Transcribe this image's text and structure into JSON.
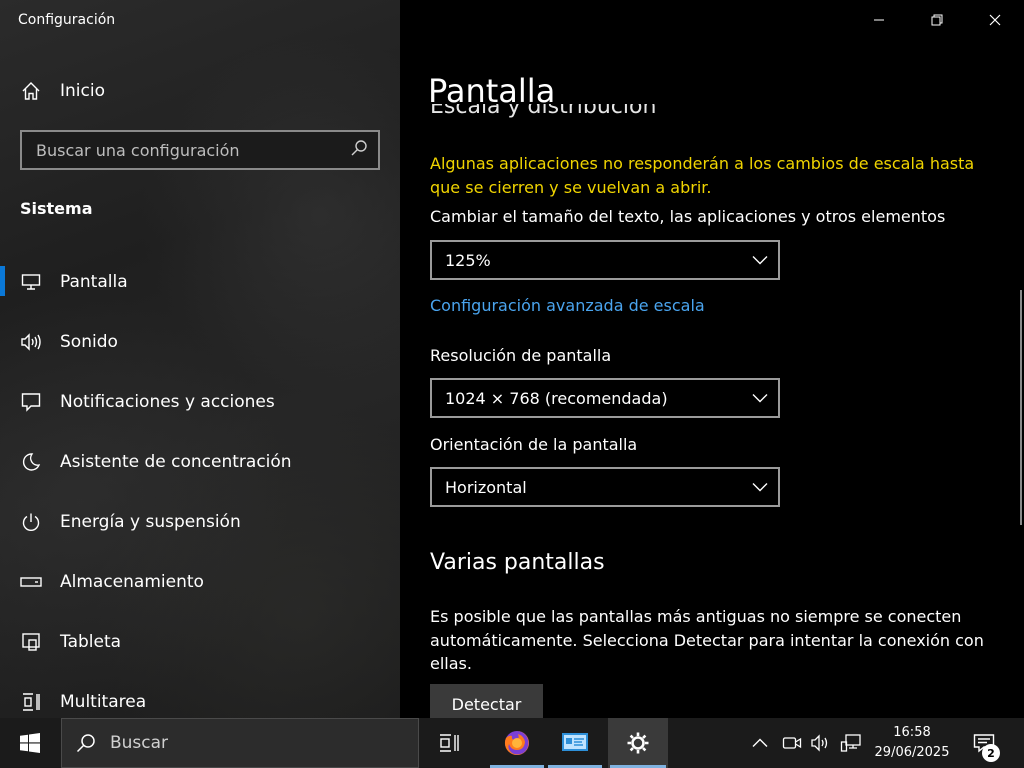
{
  "window": {
    "app_title": "Configuración"
  },
  "sidebar": {
    "home_label": "Inicio",
    "search_placeholder": "Buscar una configuración",
    "section_label": "Sistema",
    "items": [
      {
        "label": "Pantalla",
        "icon": "monitor-icon",
        "active": true
      },
      {
        "label": "Sonido",
        "icon": "speaker-icon"
      },
      {
        "label": "Notificaciones y acciones",
        "icon": "notification-icon"
      },
      {
        "label": "Asistente de concentración",
        "icon": "moon-icon"
      },
      {
        "label": "Energía y suspensión",
        "icon": "power-icon"
      },
      {
        "label": "Almacenamiento",
        "icon": "storage-icon"
      },
      {
        "label": "Tableta",
        "icon": "tablet-icon"
      },
      {
        "label": "Multitarea",
        "icon": "multitask-icon"
      }
    ]
  },
  "main": {
    "page_title": "Pantalla",
    "cut_heading": "Escala y distribución",
    "warning": "Algunas aplicaciones no responderán a los cambios de escala hasta que se cierren y se vuelvan a abrir.",
    "scale_label": "Cambiar el tamaño del texto, las aplicaciones y otros elementos",
    "scale_value": "125%",
    "advanced_link": "Configuración avanzada de escala",
    "resolution_label": "Resolución de pantalla",
    "resolution_value": "1024 × 768 (recomendada)",
    "orientation_label": "Orientación de la pantalla",
    "orientation_value": "Horizontal",
    "multi_heading": "Varias pantallas",
    "multi_text": "Es posible que las pantallas más antiguas no siempre se conecten automáticamente. Selecciona Detectar para intentar la conexión con ellas.",
    "detect_label": "Detectar"
  },
  "taskbar": {
    "search_label": "Buscar",
    "time": "16:58",
    "date": "29/06/2025",
    "notification_count": "2"
  },
  "colors": {
    "accent": "#0a78d7",
    "warning": "#f0d400",
    "link": "#4aa4ee"
  }
}
